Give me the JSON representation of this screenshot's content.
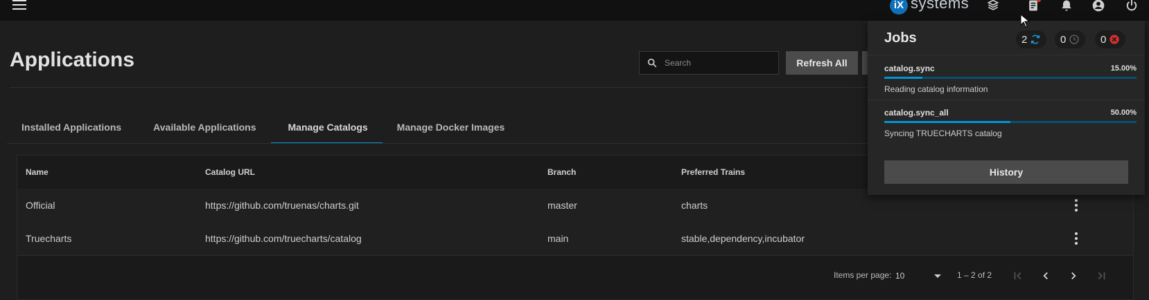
{
  "topbar": {
    "brand_mark": "iX",
    "brand_text": "systems",
    "icons": [
      "menu-icon",
      "truecommand-icon",
      "task-manager-icon",
      "notifications-icon",
      "account-icon",
      "power-icon"
    ]
  },
  "page": {
    "title": "Applications",
    "search_placeholder": "Search",
    "refresh_label": "Refresh All"
  },
  "tabs": [
    {
      "label": "Installed Applications",
      "active": false
    },
    {
      "label": "Available Applications",
      "active": false
    },
    {
      "label": "Manage Catalogs",
      "active": true
    },
    {
      "label": "Manage Docker Images",
      "active": false
    }
  ],
  "table": {
    "headers": [
      "Name",
      "Catalog URL",
      "Branch",
      "Preferred Trains"
    ],
    "rows": [
      {
        "name": "Official",
        "url": "https://github.com/truenas/charts.git",
        "branch": "master",
        "trains": "charts"
      },
      {
        "name": "Truecharts",
        "url": "https://github.com/truecharts/catalog",
        "branch": "main",
        "trains": "stable,dependency,incubator"
      }
    ],
    "paginator": {
      "items_per_page_label": "Items per page:",
      "page_size": "10",
      "range": "1 – 2 of 2"
    }
  },
  "jobs_panel": {
    "title": "Jobs",
    "counters": {
      "running": "2",
      "waiting": "0",
      "failed": "0"
    },
    "jobs": [
      {
        "name": "catalog.sync",
        "percent_label": "15.00%",
        "progress": 15,
        "description": "Reading catalog information"
      },
      {
        "name": "catalog.sync_all",
        "percent_label": "50.00%",
        "progress": 50,
        "description": "Syncing TRUECHARTS catalog"
      }
    ],
    "history_label": "History"
  },
  "colors": {
    "accent": "#0095d5",
    "background": "#1e1e1e",
    "topbar": "#111111",
    "panel": "#262626",
    "failed": "#d32f2f"
  }
}
